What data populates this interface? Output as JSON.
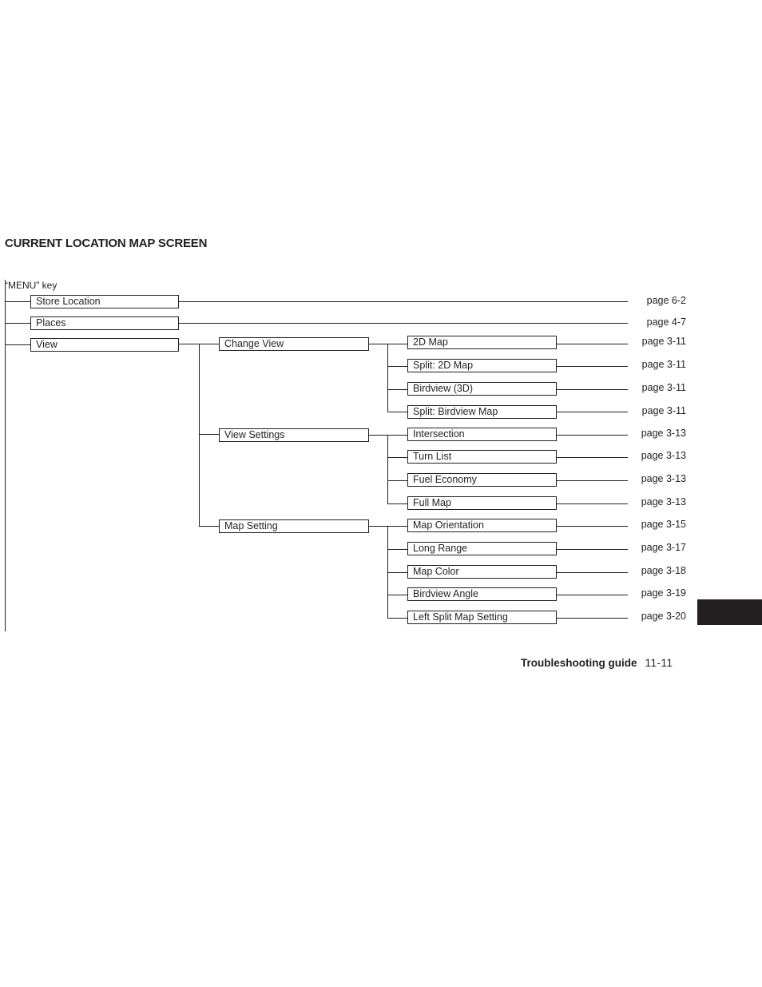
{
  "title": "CURRENT LOCATION MAP SCREEN",
  "menu_key": "“MENU” key",
  "level1": [
    {
      "label": "Store Location",
      "page": "page 6-2"
    },
    {
      "label": "Places",
      "page": "page 4-7"
    },
    {
      "label": "View",
      "page": null
    }
  ],
  "level2": [
    {
      "label": "Change View"
    },
    {
      "label": "View Settings"
    },
    {
      "label": "Map Setting"
    }
  ],
  "level3": [
    {
      "label": "2D Map",
      "page": "page 3-11"
    },
    {
      "label": "Split: 2D Map",
      "page": "page 3-11"
    },
    {
      "label": "Birdview (3D)",
      "page": "page 3-11"
    },
    {
      "label": "Split: Birdview Map",
      "page": "page 3-11"
    },
    {
      "label": "Intersection",
      "page": "page 3-13"
    },
    {
      "label": "Turn List",
      "page": "page 3-13"
    },
    {
      "label": "Fuel Economy",
      "page": "page 3-13"
    },
    {
      "label": "Full Map",
      "page": "page 3-13"
    },
    {
      "label": "Map Orientation",
      "page": "page 3-15"
    },
    {
      "label": "Long Range",
      "page": "page 3-17"
    },
    {
      "label": "Map Color",
      "page": "page 3-18"
    },
    {
      "label": "Birdview Angle",
      "page": "page 3-19"
    },
    {
      "label": "Left Split Map Setting",
      "page": "page 3-20"
    }
  ],
  "footer": {
    "section": "Troubleshooting guide",
    "page_number": "11-11"
  }
}
